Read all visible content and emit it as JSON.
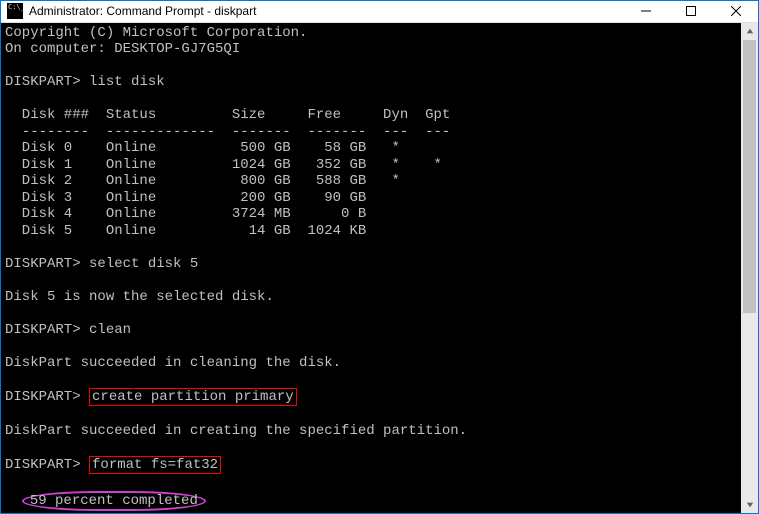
{
  "titlebar": {
    "title": "Administrator: Command Prompt - diskpart"
  },
  "term": {
    "copyright": "Copyright (C) Microsoft Corporation.",
    "computer": "On computer: DESKTOP-GJ7G5QI",
    "prompt": "DISKPART>",
    "cmd_list": "list disk",
    "hdr": "  Disk ###  Status         Size     Free     Dyn  Gpt",
    "hdr_sep": "  --------  -------------  -------  -------  ---  ---",
    "disks": [
      "  Disk 0    Online          500 GB    58 GB   *",
      "  Disk 1    Online         1024 GB   352 GB   *    *",
      "  Disk 2    Online          800 GB   588 GB   *",
      "  Disk 3    Online          200 GB    90 GB",
      "  Disk 4    Online         3724 MB      0 B",
      "  Disk 5    Online           14 GB  1024 KB"
    ],
    "cmd_select": "select disk 5",
    "msg_selected": "Disk 5 is now the selected disk.",
    "cmd_clean": "clean",
    "msg_cleaned": "DiskPart succeeded in cleaning the disk.",
    "cmd_create": "create partition primary",
    "msg_created": "DiskPart succeeded in creating the specified partition.",
    "cmd_format": "format fs=fat32",
    "progress_text": "59 percent completed",
    "indent2": "  "
  }
}
